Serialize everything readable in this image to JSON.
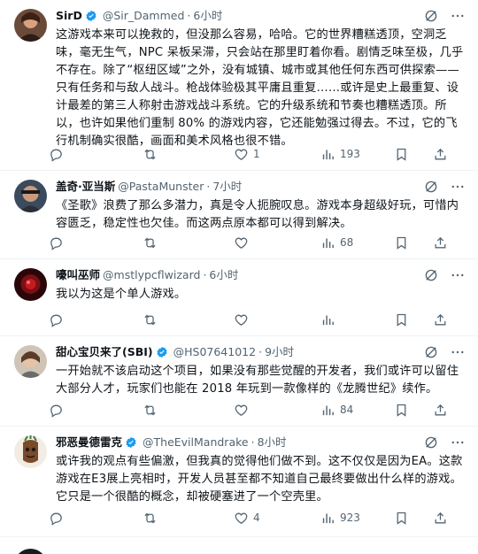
{
  "colors": {
    "text": "#0f1419",
    "muted": "#536471",
    "verified": "#1d9bf0",
    "divider": "#eff3f4"
  },
  "tweets": [
    {
      "name": "SirD",
      "verified": true,
      "handle": "@Sir_Dammed",
      "sep": "·",
      "time": "6小时",
      "text": "这游戏本来可以挽救的，但没那么容易，哈哈。它的世界糟糕透顶，空洞乏味，毫无生气，NPC 呆板呆滞，只会站在那里盯着你看。剧情乏味至极，几乎不存在。除了“枢纽区域”之外，没有城镇、城市或其他任何东西可供探索——只有任务和与敌人战斗。枪战体验极其平庸且重复……或许是史上最重复、设计最差的第三人称射击游戏战斗系统。它的升级系统和节奏也糟糕透顶。所以，也许如果他们重制 80% 的游戏内容，它还能勉强过得去。不过，它的飞行机制确实很酷，画面和美术风格也很不错。",
      "reply_count": "",
      "retweet_count": "",
      "like_count": "1",
      "view_count": "193"
    },
    {
      "name": "盖奇·亚当斯",
      "verified": false,
      "handle": "@PastaMunster",
      "sep": "·",
      "time": "7小时",
      "text": "《圣歌》浪费了那么多潜力，真是令人扼腕叹息。游戏本身超级好玩，可惜内容匮乏，稳定性也欠佳。而这两点原本都可以得到解决。",
      "reply_count": "",
      "retweet_count": "",
      "like_count": "",
      "view_count": "68"
    },
    {
      "name": "嚎叫巫师",
      "verified": false,
      "handle": "@mstlypcflwizard",
      "sep": "·",
      "time": "6小时",
      "text": "我以为这是个单人游戏。",
      "reply_count": "",
      "retweet_count": "",
      "like_count": "",
      "view_count": ""
    },
    {
      "name": "甜心宝贝来了(SBI)",
      "verified": true,
      "handle": "@HS07641012",
      "sep": "·",
      "time": "9小时",
      "text": "一开始就不该启动这个项目，如果没有那些觉醒的开发者，我们或许可以留住大部分人才，玩家们也能在 2018 年玩到一款像样的《龙腾世纪》续作。",
      "reply_count": "",
      "retweet_count": "",
      "like_count": "",
      "view_count": "84"
    },
    {
      "name": "邪恶曼德雷克",
      "verified": true,
      "handle": "@TheEvilMandrake",
      "sep": "·",
      "time": "8小时",
      "text": "或许我的观点有些偏激，但我真的觉得他们做不到。这不仅仅是因为EA。这款游戏在E3展上亮相时，开发人员甚至都不知道自己最终要做出什么样的游戏。它只是一个很酷的概念，却被硬塞进了一个空壳里。",
      "reply_count": "",
      "retweet_count": "",
      "like_count": "4",
      "view_count": "923"
    }
  ]
}
